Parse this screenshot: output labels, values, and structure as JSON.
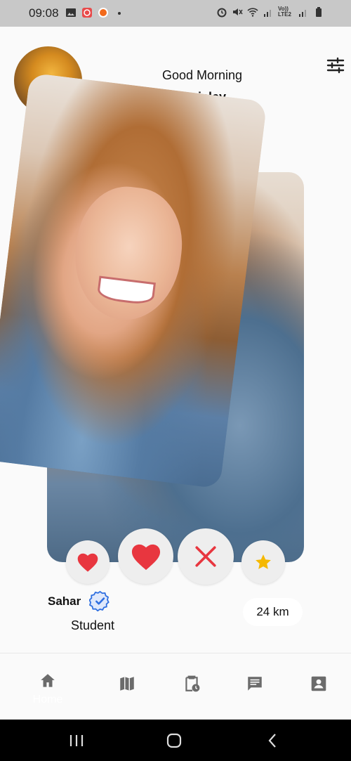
{
  "status_bar": {
    "time": "09:08",
    "icons": [
      "gallery-icon",
      "app-notification-icon",
      "app-notification-icon",
      "dot-icon",
      "alarm-icon",
      "mute-icon",
      "wifi-icon",
      "signal-icon",
      "volte-icon",
      "signal-icon",
      "battery-icon"
    ],
    "volte_label": "Vo)) LTE2"
  },
  "header": {
    "greeting": "Good Morning",
    "username": "Anisley"
  },
  "actions": {
    "like_small": "heart-icon",
    "like_big": "heart-icon",
    "dislike": "close-icon",
    "super_like": "star-icon"
  },
  "profile": {
    "name": "Sahar",
    "role": "Student",
    "distance": "24 km"
  },
  "bottom_nav": {
    "items": [
      {
        "label": "Home",
        "icon": "home-icon",
        "active": true
      },
      {
        "label": "",
        "icon": "map-icon",
        "active": false
      },
      {
        "label": "",
        "icon": "clipboard-clock-icon",
        "active": false
      },
      {
        "label": "",
        "icon": "chat-icon",
        "active": false
      },
      {
        "label": "",
        "icon": "profile-card-icon",
        "active": false
      }
    ]
  },
  "colors": {
    "accent_red": "#e8363f",
    "star_yellow": "#f5b800",
    "verified_blue": "#2f6fe0",
    "nav_icon": "#6b6b6b",
    "button_bg": "#eeeeee"
  }
}
